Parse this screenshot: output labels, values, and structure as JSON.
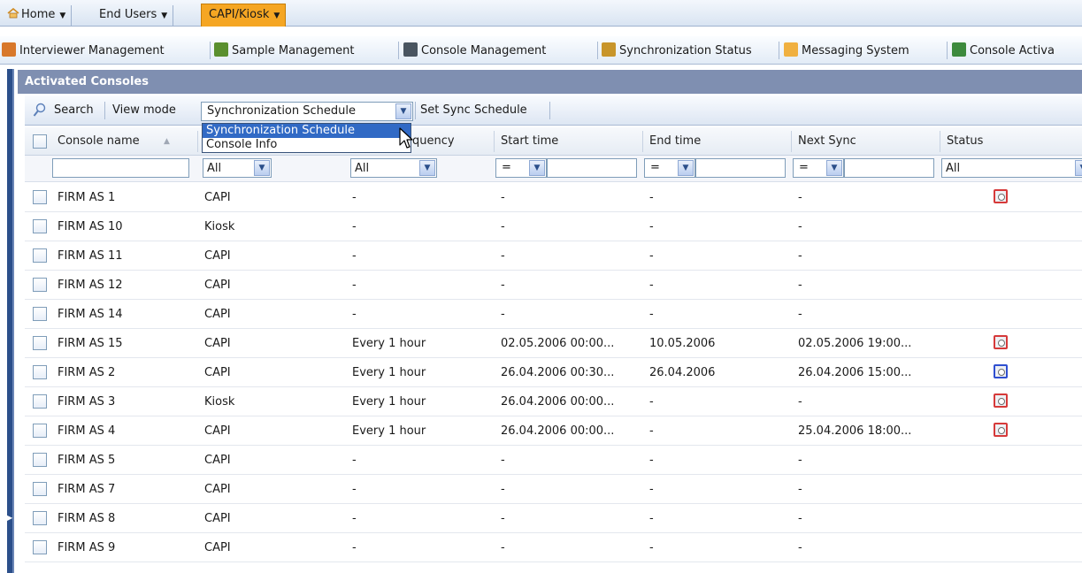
{
  "tabs": {
    "home": "Home",
    "end_users": "End Users",
    "capi": "CAPI/Kiosk"
  },
  "modules": [
    {
      "label": "Interviewer Management",
      "color": "#d8782a"
    },
    {
      "label": "Sample Management",
      "color": "#5a8f2e"
    },
    {
      "label": "Console Management",
      "color": "#4a5560"
    },
    {
      "label": "Synchronization Status",
      "color": "#c8952a"
    },
    {
      "label": "Messaging System",
      "color": "#f0b040"
    },
    {
      "label": "Console Activa",
      "color": "#3d8a3d"
    }
  ],
  "panel": {
    "title": "Activated Consoles"
  },
  "toolbar": {
    "search": "Search",
    "view_mode_label": "View mode",
    "view_mode_value": "Synchronization Schedule",
    "set_sync": "Set Sync Schedule"
  },
  "dropdown": {
    "options": [
      "Synchronization Schedule",
      "Console Info"
    ],
    "selected": "Synchronization Schedule"
  },
  "columns": {
    "console_name": "Console name",
    "type": "",
    "frequency": "quency",
    "start_time": "Start time",
    "end_time": "End time",
    "next_sync": "Next Sync",
    "status": "Status"
  },
  "filters": {
    "type": "All",
    "frequency": "All",
    "start_op": "=",
    "end_op": "=",
    "next_op": "=",
    "status": "All"
  },
  "status_colors": {
    "red": "#d63a3a",
    "blue": "#2f4fd0"
  },
  "rows": [
    {
      "name": "FIRM AS 1",
      "type": "CAPI",
      "frequency": "-",
      "start": "-",
      "end": "-",
      "next": "-",
      "status": "red"
    },
    {
      "name": "FIRM AS 10",
      "type": "Kiosk",
      "frequency": "-",
      "start": "-",
      "end": "-",
      "next": "-",
      "status": ""
    },
    {
      "name": "FIRM AS 11",
      "type": "CAPI",
      "frequency": "-",
      "start": "-",
      "end": "-",
      "next": "-",
      "status": ""
    },
    {
      "name": "FIRM AS 12",
      "type": "CAPI",
      "frequency": "-",
      "start": "-",
      "end": "-",
      "next": "-",
      "status": ""
    },
    {
      "name": "FIRM AS 14",
      "type": "CAPI",
      "frequency": "-",
      "start": "-",
      "end": "-",
      "next": "-",
      "status": ""
    },
    {
      "name": "FIRM AS 15",
      "type": "CAPI",
      "frequency": "Every 1 hour",
      "start": "02.05.2006 00:00...",
      "end": "10.05.2006",
      "next": "02.05.2006 19:00...",
      "status": "red"
    },
    {
      "name": "FIRM AS 2",
      "type": "CAPI",
      "frequency": "Every 1 hour",
      "start": "26.04.2006 00:30...",
      "end": "26.04.2006",
      "next": "26.04.2006 15:00...",
      "status": "blue"
    },
    {
      "name": "FIRM AS 3",
      "type": "Kiosk",
      "frequency": "Every 1 hour",
      "start": "26.04.2006 00:00...",
      "end": "-",
      "next": "-",
      "status": "red"
    },
    {
      "name": "FIRM AS 4",
      "type": "CAPI",
      "frequency": "Every 1 hour",
      "start": "26.04.2006 00:00...",
      "end": "-",
      "next": "25.04.2006 18:00...",
      "status": "red"
    },
    {
      "name": "FIRM AS 5",
      "type": "CAPI",
      "frequency": "-",
      "start": "-",
      "end": "-",
      "next": "-",
      "status": ""
    },
    {
      "name": "FIRM AS 7",
      "type": "CAPI",
      "frequency": "-",
      "start": "-",
      "end": "-",
      "next": "-",
      "status": ""
    },
    {
      "name": "FIRM AS 8",
      "type": "CAPI",
      "frequency": "-",
      "start": "-",
      "end": "-",
      "next": "-",
      "status": ""
    },
    {
      "name": "FIRM AS 9",
      "type": "CAPI",
      "frequency": "-",
      "start": "-",
      "end": "-",
      "next": "-",
      "status": ""
    }
  ]
}
